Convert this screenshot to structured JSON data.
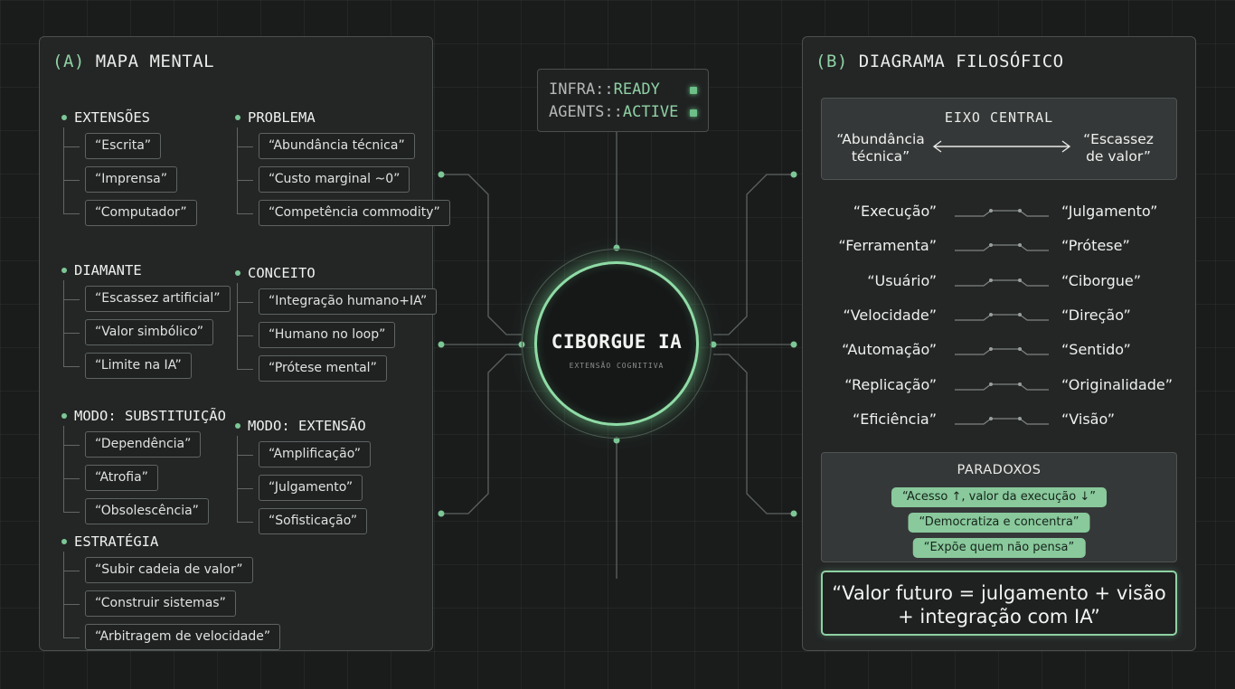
{
  "panel_a": {
    "tag": "(A)",
    "title": "MAPA MENTAL",
    "groups": [
      {
        "heading": "EXTENSÕES",
        "items": [
          "“Escrita”",
          "“Imprensa”",
          "“Computador”"
        ]
      },
      {
        "heading": "PROBLEMA",
        "items": [
          "“Abundância técnica”",
          "“Custo marginal ~0”",
          "“Competência commodity”"
        ]
      },
      {
        "heading": "DIAMANTE",
        "items": [
          "“Escassez artificial”",
          "“Valor simbólico”",
          "“Limite na IA”"
        ]
      },
      {
        "heading": "CONCEITO",
        "items": [
          "“Integração humano+IA”",
          "“Humano no loop”",
          "“Prótese mental”"
        ]
      },
      {
        "heading": "MODO: SUBSTITUIÇÃO",
        "items": [
          "“Dependência”",
          "“Atrofia”",
          "“Obsolescência”"
        ]
      },
      {
        "heading": "MODO: EXTENSÃO",
        "items": [
          "“Amplificação”",
          "“Julgamento”",
          "“Sofisticação”"
        ]
      },
      {
        "heading": "ESTRATÉGIA",
        "items": [
          "“Subir cadeia de valor”",
          "“Construir sistemas”",
          "“Arbitragem de velocidade”"
        ]
      }
    ]
  },
  "status": {
    "rows": [
      {
        "key": "INFRA::",
        "value": "READY"
      },
      {
        "key": "AGENTS::",
        "value": "ACTIVE"
      }
    ]
  },
  "core": {
    "title": "CIBORGUE IA",
    "subtitle": "EXTENSÃO COGNITIVA"
  },
  "panel_b": {
    "tag": "(B)",
    "title": "DIAGRAMA FILOSÓFICO",
    "axis": {
      "title": "EIXO CENTRAL",
      "left": "“Abundância técnica”",
      "right": "“Escassez de valor”"
    },
    "pairs": [
      {
        "left": "“Execução”",
        "right": "“Julgamento”"
      },
      {
        "left": "“Ferramenta”",
        "right": "“Prótese”"
      },
      {
        "left": "“Usuário”",
        "right": "“Ciborgue”"
      },
      {
        "left": "“Velocidade”",
        "right": "“Direção”"
      },
      {
        "left": "“Automação”",
        "right": "“Sentido”"
      },
      {
        "left": "“Replicação”",
        "right": "“Originalidade”"
      },
      {
        "left": "“Eficiência”",
        "right": "“Visão”"
      }
    ],
    "paradoxes": {
      "title": "PARADOXOS",
      "items": [
        "“Acesso ↑, valor da execução ↓”",
        "“Democratiza e concentra”",
        "“Expõe quem não pensa”"
      ]
    },
    "final": "“Valor futuro = julgamento + visão + integração com IA”"
  },
  "colors": {
    "accent": "#8fd1a4",
    "background": "#1a1c1c",
    "panel": "#242626"
  }
}
